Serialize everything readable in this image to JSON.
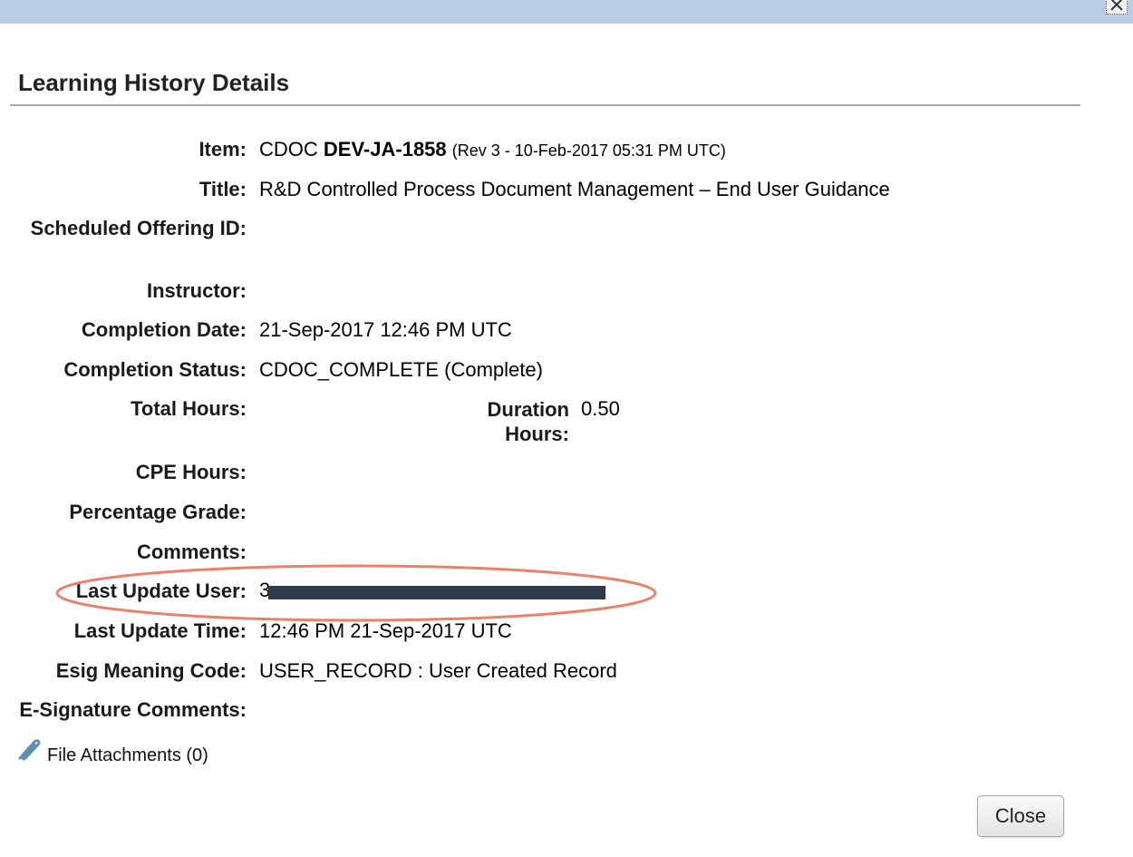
{
  "dialog": {
    "title": "Learning History Details",
    "close_button_label": "Close"
  },
  "fields": {
    "item_label": "Item:",
    "item_type": "CDOC",
    "item_id": "DEV-JA-1858",
    "item_rev": "(Rev 3 - 10-Feb-2017 05:31 PM UTC)",
    "title_label": "Title:",
    "title_value": "R&D Controlled Process Document Management – End User Guidance",
    "scheduled_offering_label": "Scheduled Offering ID:",
    "instructor_label": "Instructor:",
    "completion_date_label": "Completion Date:",
    "completion_date_value": "21-Sep-2017 12:46 PM UTC",
    "completion_status_label": "Completion Status:",
    "completion_status_value": "CDOC_COMPLETE (Complete)",
    "total_hours_label": "Total Hours:",
    "duration_hours_label_1": "Duration",
    "duration_hours_label_2": "Hours:",
    "duration_hours_value": "0.50",
    "cpe_hours_label": "CPE Hours:",
    "percentage_grade_label": "Percentage Grade:",
    "comments_label": "Comments:",
    "last_update_user_label": "Last Update User:",
    "last_update_user_visible_prefix": "3",
    "last_update_time_label": "Last Update Time:",
    "last_update_time_value": "12:46 PM 21-Sep-2017 UTC",
    "esig_meaning_label": "Esig Meaning Code:",
    "esig_meaning_value": "USER_RECORD : User Created Record",
    "esig_comments_label": "E-Signature Comments:"
  },
  "attachments": {
    "label": "File Attachments (0)",
    "icon": "paperclip-icon"
  },
  "colors": {
    "topbar": "#b8cce4",
    "highlight_oval": "#e8826a",
    "redaction": "#2c3a4a"
  }
}
